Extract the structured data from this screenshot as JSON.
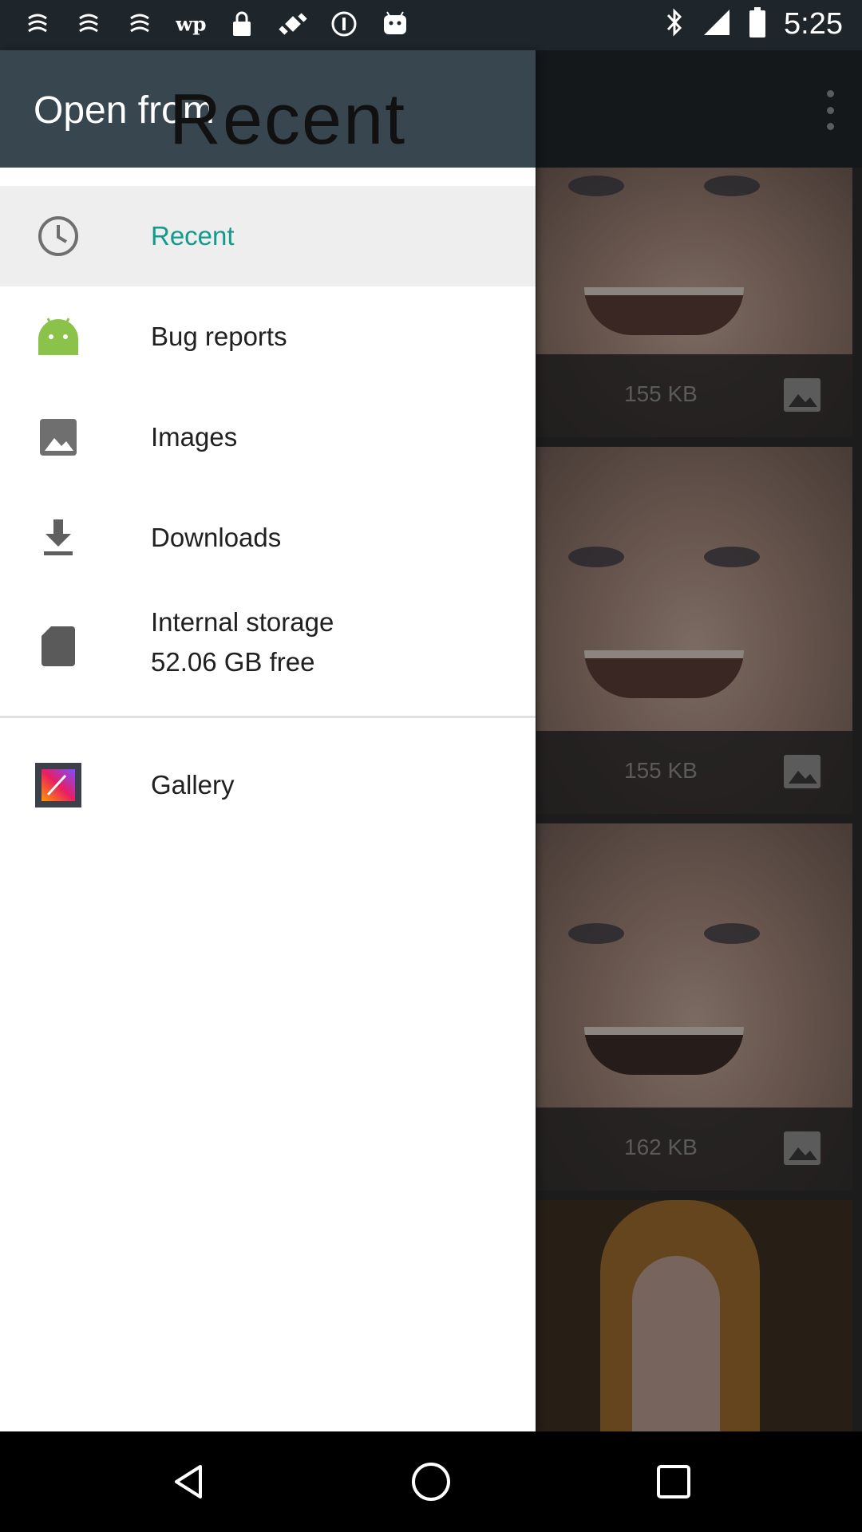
{
  "status_bar": {
    "time": "5:25",
    "left_icons": [
      "notification-icon",
      "notification-icon",
      "notification-icon",
      "wp-icon",
      "lock-icon",
      "fake-gps-icon",
      "info-icon",
      "android-debug-icon"
    ],
    "right_icons": [
      "bluetooth-icon",
      "signal-icon",
      "battery-icon"
    ]
  },
  "drawer": {
    "title": "Open from",
    "overlay_title": "Recent",
    "items": [
      {
        "label": "Recent",
        "icon": "clock-icon",
        "active": true
      },
      {
        "label": "Bug reports",
        "icon": "android-icon",
        "active": false
      },
      {
        "label": "Images",
        "icon": "image-icon",
        "active": false
      },
      {
        "label": "Downloads",
        "icon": "download-icon",
        "active": false
      },
      {
        "label": "Internal storage",
        "sublabel": "52.06 GB free",
        "icon": "sd-card-icon",
        "active": false
      }
    ],
    "apps": [
      {
        "label": "Gallery",
        "icon": "gallery-app-icon"
      }
    ]
  },
  "thumbnails": [
    {
      "size": "155 KB"
    },
    {
      "size": "155 KB"
    },
    {
      "size": "162 KB"
    }
  ],
  "colors": {
    "accent": "#129a8c",
    "header": "#38474f",
    "statusbar": "#1f262b"
  }
}
